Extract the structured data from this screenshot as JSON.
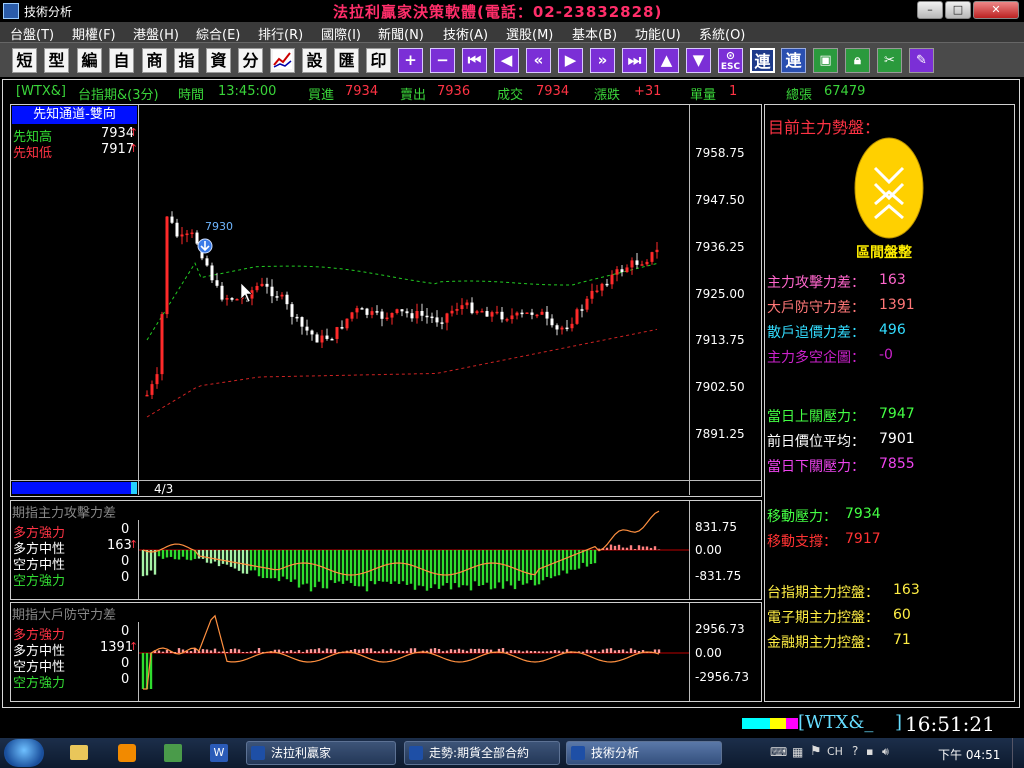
{
  "window": {
    "title": "技術分析",
    "app_title": "法拉利贏家決策軟體(電話：02-23832828)",
    "controls": [
      "–",
      "□",
      "✕"
    ]
  },
  "menu": [
    "台盤(T)",
    "期權(F)",
    "港盤(H)",
    "綜合(E)",
    "排行(R)",
    "國際(I)",
    "新聞(N)",
    "技術(A)",
    "選股(M)",
    "基本(B)",
    "功能(U)",
    "系統(O)"
  ],
  "toolbar": {
    "text_buttons": [
      "短",
      "型",
      "編",
      "自",
      "商",
      "指",
      "資",
      "分"
    ],
    "text_buttons2": [
      "設",
      "匯",
      "印"
    ],
    "highlight_buttons": [
      "連",
      "連"
    ],
    "escape_label": "ESC"
  },
  "quote": {
    "symbol": "[WTX&]",
    "name": "台指期&(3分)",
    "time_label": "時間",
    "time": "13:45:00",
    "bid_label": "買進",
    "bid": "7934",
    "ask_label": "賣出",
    "ask": "7936",
    "deal_label": "成交",
    "deal": "7934",
    "change_label": "漲跌",
    "change": "+31",
    "volume_label": "單量",
    "volume": "1",
    "total_label": "總張",
    "total": "67479"
  },
  "main_panel": {
    "tag": "先知通道-雙向",
    "high_label": "先知高",
    "high": "7934",
    "low_label": "先知低",
    "low": "7917",
    "date": "4/3",
    "price_callout": "7930",
    "y_ticks": [
      "7958.75",
      "7947.50",
      "7936.25",
      "7925.00",
      "7913.75",
      "7902.50",
      "7891.25"
    ]
  },
  "attack_panel": {
    "title": "期指主力攻擊力差",
    "rows": [
      {
        "label": "多方強力",
        "value": "0"
      },
      {
        "label": "多方中性",
        "value": "163"
      },
      {
        "label": "空方中性",
        "value": "0"
      },
      {
        "label": "空方強力",
        "value": "0"
      }
    ],
    "y_ticks": [
      "831.75",
      "0.00",
      "-831.75"
    ]
  },
  "defense_panel": {
    "title": "期指大戶防守力差",
    "rows": [
      {
        "label": "多方強力",
        "value": "0"
      },
      {
        "label": "多方中性",
        "value": "1391"
      },
      {
        "label": "空方中性",
        "value": "0"
      },
      {
        "label": "空方強力",
        "value": "0"
      }
    ],
    "y_ticks": [
      "2956.73",
      "0.00",
      "-2956.73"
    ]
  },
  "side_panel": {
    "title": "目前主力勢盤：",
    "badge_label": "區間盤整",
    "stats": [
      {
        "label": "主力攻擊力差：",
        "value": "163",
        "color": "#ff66cc"
      },
      {
        "label": "大戶防守力差：",
        "value": "1391",
        "color": "#ff7777"
      },
      {
        "label": "散戶追價力差：",
        "value": "496",
        "color": "#33ddff"
      },
      {
        "label": "主力多空企圖：",
        "value": "-0",
        "color": "#cc22cc"
      }
    ],
    "levels": [
      {
        "label": "當日上關壓力：",
        "value": "7947",
        "color": "#44ff44"
      },
      {
        "label": "前日價位平均：",
        "value": "7901",
        "color": "#ffffff"
      },
      {
        "label": "當日下關壓力：",
        "value": "7855",
        "color": "#ee44ee"
      }
    ],
    "moves": [
      {
        "label": "移動壓力：",
        "value": "7934",
        "color": "#44ff44"
      },
      {
        "label": "移動支撐：",
        "value": "7917",
        "color": "#ff3333"
      }
    ],
    "controls": [
      {
        "label": "台指期主力控盤：",
        "value": "163",
        "color": "#ffee44"
      },
      {
        "label": "電子期主力控盤：",
        "value": "60",
        "color": "#ffee44"
      },
      {
        "label": "金融期主力控盤：",
        "value": "71",
        "color": "#ffee44"
      }
    ]
  },
  "status": {
    "ticker": "[WTX&_",
    "clock": "16:51:21"
  },
  "taskbar": {
    "tasks": [
      "法拉利贏家",
      "走勢:期貨全部合約",
      "技術分析"
    ],
    "clock": "下午 04:51"
  }
}
